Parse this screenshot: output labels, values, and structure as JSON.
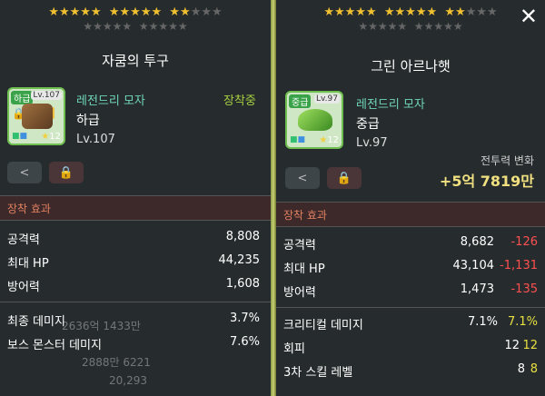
{
  "left": {
    "stars_row1": "★★★★★ ★★★★★ ★★★★★",
    "stars_row2": "★★★★★ ★★★★★",
    "title": "자쿰의 투구",
    "grade_badge": "하급",
    "lv_badge": "Lv.107",
    "star_level": "12",
    "item_name": "레전드리 모자",
    "grade_text": "하급",
    "level_text": "Lv.107",
    "equipped": "장착중",
    "section": "장착 효과",
    "stats": [
      {
        "name": "공격력",
        "value": "8,808"
      },
      {
        "name": "최대 HP",
        "value": "44,235"
      },
      {
        "name": "방어력",
        "value": "1,608"
      }
    ],
    "extra_stats": [
      {
        "name": "최종 데미지",
        "value": "3.7%"
      },
      {
        "name": "보스 몬스터 데미지",
        "value": "7.6%"
      }
    ],
    "bg_text": [
      "2636억 1433만",
      "2888만 6221",
      "20,293"
    ]
  },
  "right": {
    "stars_row1": "★★★★★ ★★★★★ ★★★★★",
    "stars_row2": "★★★★★ ★★★★★",
    "title": "그린 아르나햇",
    "grade_badge": "중급",
    "lv_badge": "Lv.97",
    "star_level": "12",
    "item_name": "레전드리 모자",
    "grade_text": "중급",
    "level_text": "Lv.97",
    "cp_label": "전투력 변화",
    "cp_value": "+5억 7819만",
    "section": "장착 효과",
    "stats": [
      {
        "name": "공격력",
        "value": "8,682",
        "diff": "-126",
        "dir": "neg"
      },
      {
        "name": "최대 HP",
        "value": "43,104",
        "diff": "-1,131",
        "dir": "neg"
      },
      {
        "name": "방어력",
        "value": "1,473",
        "diff": "-135",
        "dir": "neg"
      }
    ],
    "extra_stats": [
      {
        "name": "크리티컬 데미지",
        "value": "7.1%",
        "diff": "7.1%",
        "dir": "pos"
      },
      {
        "name": "회피",
        "value": "12",
        "diff": "12",
        "dir": "pos"
      },
      {
        "name": "3차 스킬 레벨",
        "value": "8",
        "diff": "8",
        "dir": "pos"
      }
    ]
  },
  "icons": {
    "close": "✕",
    "share": "⋖",
    "lock": "🔒"
  },
  "colors": {
    "item_name": "#6fd6b8",
    "equipped": "#a8d040",
    "negative": "#ff5050",
    "positive": "#e8e040",
    "combat_power": "#f0e080"
  }
}
